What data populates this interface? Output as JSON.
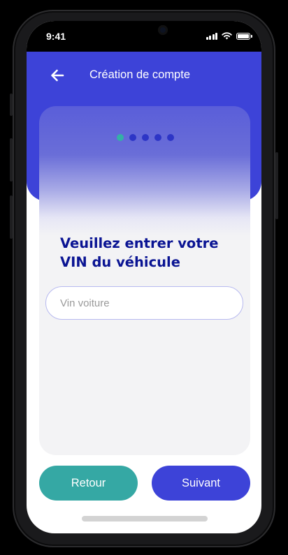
{
  "status_bar": {
    "time": "9:41"
  },
  "header": {
    "title": "Création de compte"
  },
  "stepper": {
    "total_steps": 5,
    "current_step": 1,
    "active_color": "#34b0a6",
    "inactive_color": "#2d35c6"
  },
  "form": {
    "question": "Veuillez entrer votre VIN du véhicule",
    "vin_value": "",
    "vin_placeholder": "Vin voiture"
  },
  "buttons": {
    "back_label": "Retour",
    "next_label": "Suivant"
  },
  "colors": {
    "brand_blue": "#3d43d8",
    "title_navy": "#0a1493",
    "accent_teal": "#35a8a4"
  },
  "icons": {
    "back": "arrow-left-icon",
    "signal": "cellular-signal-icon",
    "wifi": "wifi-icon",
    "battery": "battery-icon"
  }
}
